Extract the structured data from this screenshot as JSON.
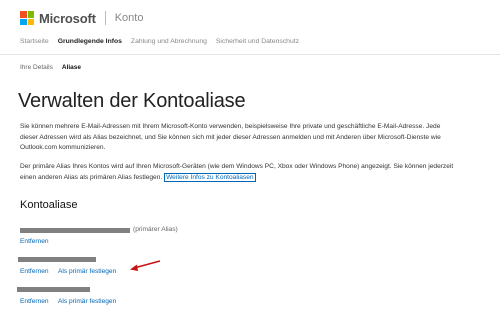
{
  "header": {
    "brand": "Microsoft",
    "app_name": "Konto",
    "logo_colors": [
      "#f25022",
      "#7fba00",
      "#00a4ef",
      "#ffb900"
    ]
  },
  "nav": {
    "items": [
      {
        "label": "Startseite"
      },
      {
        "label": "Grundlegende Infos"
      },
      {
        "label": "Zahlung und Abrechnung"
      },
      {
        "label": "Sicherheit und Datenschutz"
      }
    ],
    "active_index": 1
  },
  "subnav": {
    "items": [
      {
        "label": "Ihre Details"
      },
      {
        "label": "Aliase"
      }
    ],
    "active_index": 1
  },
  "page": {
    "title": "Verwalten der Kontoaliase",
    "paragraph1": "Sie können mehrere E-Mail-Adressen mit Ihrem Microsoft-Konto verwenden, beispielsweise Ihre private und geschäftliche E-Mail-Adresse. Jede dieser Adressen wird als Alias bezeichnet, und Sie können sich mit jeder dieser Adressen anmelden und mit Anderen über Microsoft-Dienste wie Outlook.com kommunizieren.",
    "paragraph2": "Der primäre Alias Ihres Kontos wird auf Ihren Microsoft-Geräten (wie dem Windows PC, Xbox oder Windows Phone) angezeigt. Sie können jederzeit einen anderen Alias als primären Alias festlegen.",
    "more_link": "Weitere Infos zu Kontoaliasen"
  },
  "aliases": {
    "heading": "Kontoaliase",
    "primary_label": "(primärer Alias)",
    "remove_label": "Entfernen",
    "make_primary_label": "Als primär festlegen"
  },
  "colors": {
    "link": "#0067b8",
    "annotation_arrow": "#cc1111",
    "redaction": "#808080"
  }
}
